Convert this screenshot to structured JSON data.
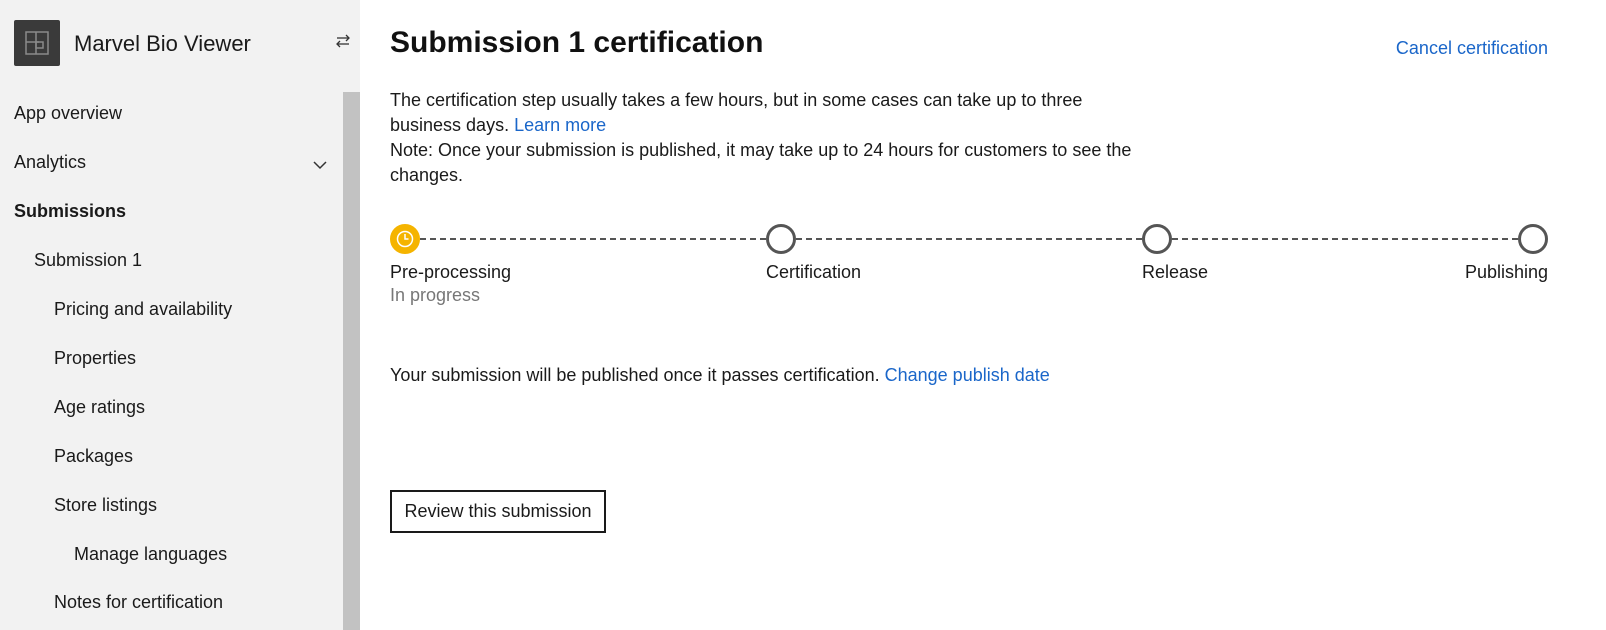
{
  "app": {
    "name": "Marvel Bio Viewer"
  },
  "sidebar": {
    "items": [
      {
        "label": "App overview"
      },
      {
        "label": "Analytics"
      },
      {
        "label": "Submissions"
      },
      {
        "label": "Submission 1"
      },
      {
        "label": "Pricing and availability"
      },
      {
        "label": "Properties"
      },
      {
        "label": "Age ratings"
      },
      {
        "label": "Packages"
      },
      {
        "label": "Store listings"
      },
      {
        "label": "Manage languages"
      },
      {
        "label": "Notes for certification"
      }
    ]
  },
  "main": {
    "title": "Submission 1 certification",
    "cancel_link": "Cancel certification",
    "desc_line1": "The certification step usually takes a few hours, but in some cases can take up to three",
    "desc_line2": "business days.",
    "learn_more": "Learn more",
    "desc_line3": "Note: Once your submission is published, it may take up to 24 hours for customers to see the",
    "desc_line4": "changes.",
    "steps": [
      {
        "label": "Pre-processing",
        "status": "In progress"
      },
      {
        "label": "Certification"
      },
      {
        "label": "Release"
      },
      {
        "label": "Publishing"
      }
    ],
    "publish_note": "Your submission will be published once it passes certification.",
    "change_publish_link": "Change publish date",
    "review_button": "Review this submission"
  },
  "colors": {
    "accent_link": "#1a66c9",
    "active_step": "#f5b400",
    "sidebar_bg": "#f2f2f2"
  }
}
